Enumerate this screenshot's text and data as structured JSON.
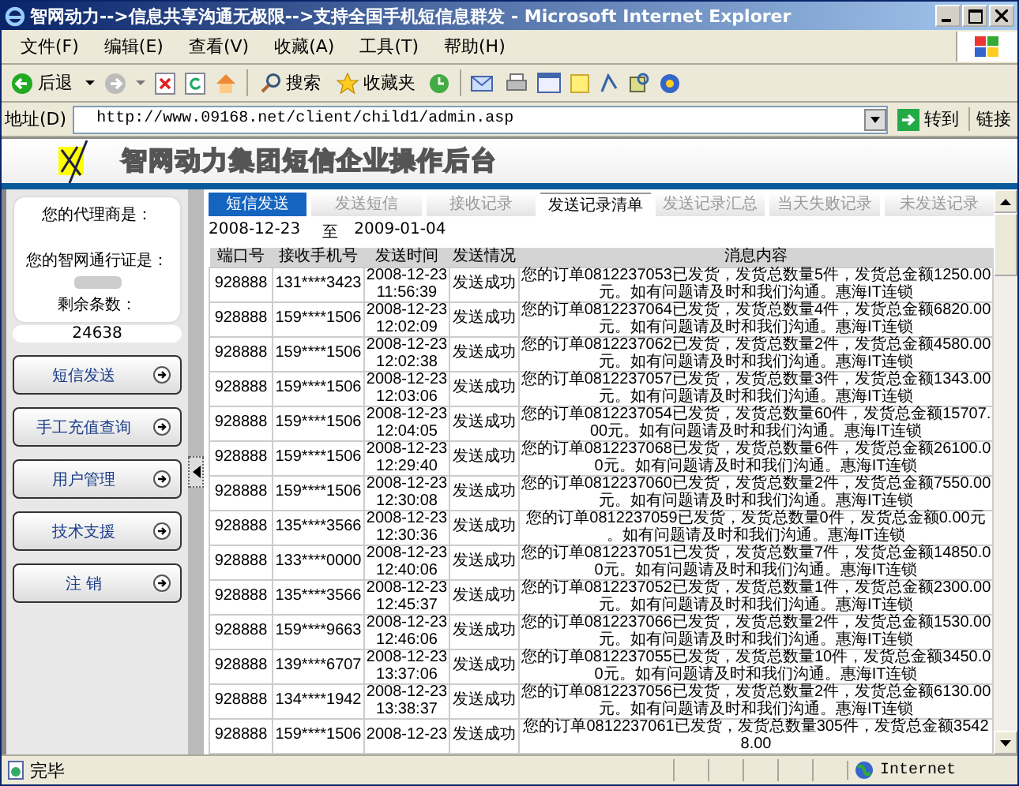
{
  "window": {
    "title": "智网动力-->信息共享沟通无极限-->支持全国手机短信息群发 - Microsoft Internet Explorer"
  },
  "menu": [
    "文件(F)",
    "编辑(E)",
    "查看(V)",
    "收藏(A)",
    "工具(T)",
    "帮助(H)"
  ],
  "toolbar": {
    "back": "后退",
    "search": "搜索",
    "favorites": "收藏夹"
  },
  "address": {
    "label": "地址(D)",
    "url": "http://www.09168.net/client/child1/admin.asp",
    "go": "转到",
    "links": "链接"
  },
  "header": {
    "title": "智网动力集团短信企业操作后台"
  },
  "sidebar": {
    "agent_label": "您的代理商是：",
    "pass_label": "您的智网通行证是：",
    "remaining_label": "剩余条数：",
    "remaining": "24638",
    "buttons": [
      "短信发送",
      "手工充值查询",
      "用户管理",
      "技术支援",
      "注 销"
    ]
  },
  "section_label": "短信发送",
  "tabs": [
    {
      "label": "发送短信",
      "selected": false
    },
    {
      "label": "接收记录",
      "selected": false
    },
    {
      "label": "发送记录清单",
      "selected": true
    },
    {
      "label": "发送记录汇总",
      "selected": false
    },
    {
      "label": "当天失败记录",
      "selected": false
    },
    {
      "label": "未发送记录",
      "selected": false
    }
  ],
  "date_range": {
    "from": "2008-12-23",
    "separator": "至",
    "to": "2009-01-04"
  },
  "table": {
    "columns": [
      "端口号",
      "接收手机号",
      "发送时间",
      "发送情况",
      "消息内容"
    ],
    "rows": [
      [
        "928888",
        "131****3423",
        "2008-12-23 11:56:39",
        "发送成功",
        "您的订单0812237053已发货，发货总数量5件，发货总金额1250.00元。如有问题请及时和我们沟通。惠海IT连锁"
      ],
      [
        "928888",
        "159****1506",
        "2008-12-23 12:02:09",
        "发送成功",
        "您的订单0812237064已发货，发货总数量4件，发货总金额6820.00元。如有问题请及时和我们沟通。惠海IT连锁"
      ],
      [
        "928888",
        "159****1506",
        "2008-12-23 12:02:38",
        "发送成功",
        "您的订单0812237062已发货，发货总数量2件，发货总金额4580.00元。如有问题请及时和我们沟通。惠海IT连锁"
      ],
      [
        "928888",
        "159****1506",
        "2008-12-23 12:03:06",
        "发送成功",
        "您的订单0812237057已发货，发货总数量3件，发货总金额1343.00元。如有问题请及时和我们沟通。惠海IT连锁"
      ],
      [
        "928888",
        "159****1506",
        "2008-12-23 12:04:05",
        "发送成功",
        "您的订单0812237054已发货，发货总数量60件，发货总金额15707.00元。如有问题请及时和我们沟通。惠海IT连锁"
      ],
      [
        "928888",
        "159****1506",
        "2008-12-23 12:29:40",
        "发送成功",
        "您的订单0812237068已发货，发货总数量6件，发货总金额26100.00元。如有问题请及时和我们沟通。惠海IT连锁"
      ],
      [
        "928888",
        "159****1506",
        "2008-12-23 12:30:08",
        "发送成功",
        "您的订单0812237060已发货，发货总数量2件，发货总金额7550.00元。如有问题请及时和我们沟通。惠海IT连锁"
      ],
      [
        "928888",
        "135****3566",
        "2008-12-23 12:30:36",
        "发送成功",
        "您的订单0812237059已发货，发货总数量0件，发货总金额0.00元。如有问题请及时和我们沟通。惠海IT连锁"
      ],
      [
        "928888",
        "133****0000",
        "2008-12-23 12:40:06",
        "发送成功",
        "您的订单0812237051已发货，发货总数量7件，发货总金额14850.00元。如有问题请及时和我们沟通。惠海IT连锁"
      ],
      [
        "928888",
        "135****3566",
        "2008-12-23 12:45:37",
        "发送成功",
        "您的订单0812237052已发货，发货总数量1件，发货总金额2300.00元。如有问题请及时和我们沟通。惠海IT连锁"
      ],
      [
        "928888",
        "159****9663",
        "2008-12-23 12:46:06",
        "发送成功",
        "您的订单0812237066已发货，发货总数量2件，发货总金额1530.00元。如有问题请及时和我们沟通。惠海IT连锁"
      ],
      [
        "928888",
        "139****6707",
        "2008-12-23 13:37:06",
        "发送成功",
        "您的订单0812237055已发货，发货总数量10件，发货总金额3450.00元。如有问题请及时和我们沟通。惠海IT连锁"
      ],
      [
        "928888",
        "134****1942",
        "2008-12-23 13:38:37",
        "发送成功",
        "您的订单0812237056已发货，发货总数量2件，发货总金额6130.00元。如有问题请及时和我们沟通。惠海IT连锁"
      ],
      [
        "928888",
        "159****1506",
        "2008-12-23",
        "发送成功",
        "您的订单0812237061已发货，发货总数量305件，发货总金额35428.00"
      ]
    ]
  },
  "status_bar": {
    "text": "完毕",
    "zone": "Internet"
  }
}
